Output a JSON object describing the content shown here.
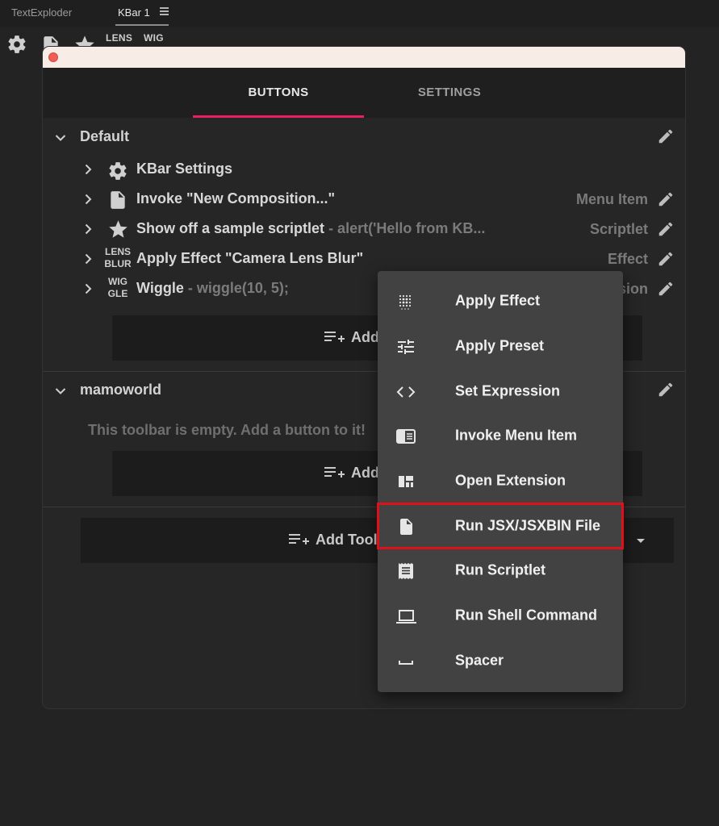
{
  "panel_tabs": [
    {
      "label": "TextExploder"
    },
    {
      "label": "KBar 1"
    }
  ],
  "kbar_strip": {
    "text1": "LENS",
    "text2": "WIG"
  },
  "tabs": [
    {
      "label": "BUTTONS",
      "active": true
    },
    {
      "label": "SETTINGS",
      "active": false
    }
  ],
  "accent_color": "#e91e63",
  "groups": [
    {
      "title": "Default",
      "rows": [
        {
          "label": "KBar Settings",
          "sub": "",
          "type": "",
          "icon": "gear-icon"
        },
        {
          "label": "Invoke \"New Composition...\"",
          "sub": "",
          "type": "Menu Item",
          "icon": "file-icon"
        },
        {
          "label": "Show off a sample scriptlet",
          "sub": " - alert('Hello from KB...",
          "type": "Scriptlet",
          "icon": "star-icon"
        },
        {
          "label": "Apply Effect \"Camera Lens Blur\"",
          "sub": "",
          "type": "Effect",
          "icon_text": [
            "LENS",
            "BLUR"
          ]
        },
        {
          "label": "Wiggle",
          "sub": " - wiggle(10, 5);",
          "type": "sion",
          "icon_text": [
            "WIG",
            "GLE"
          ]
        }
      ],
      "add_label": "Add"
    },
    {
      "title": "mamoworld",
      "empty_message": "This toolbar is empty. Add a button to it!",
      "add_label": "Add"
    }
  ],
  "add_toolbar_label": "Add Tool",
  "menu": {
    "items": [
      {
        "label": "Apply Effect",
        "icon": "dots-grid-icon"
      },
      {
        "label": "Apply Preset",
        "icon": "sliders-icon"
      },
      {
        "label": "Set Expression",
        "icon": "code-icon"
      },
      {
        "label": "Invoke Menu Item",
        "icon": "menu-window-icon"
      },
      {
        "label": "Open Extension",
        "icon": "extension-layout-icon"
      },
      {
        "label": "Run JSX/JSXBIN File",
        "icon": "file-icon",
        "highlighted": true
      },
      {
        "label": "Run Scriptlet",
        "icon": "scriptlet-icon"
      },
      {
        "label": "Run Shell Command",
        "icon": "laptop-icon"
      },
      {
        "label": "Spacer",
        "icon": "spacer-icon"
      }
    ]
  },
  "highlight_color": "#e0101a"
}
